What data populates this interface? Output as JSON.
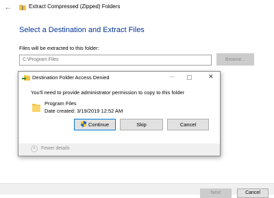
{
  "wizard": {
    "back_icon": "back-arrow-icon",
    "title_icon": "zip-folder-icon",
    "title": "Extract Compressed (Zipped) Folders",
    "heading": "Select a Destination and Extract Files",
    "files_label": "Files will be extracted to this folder:",
    "path_value": "C:\\Program Files",
    "browse_label": "Browse...",
    "next_label": "Next",
    "cancel_label": "Cancel",
    "colors": {
      "heading": "#003399",
      "disabled_button": "#cccccc"
    }
  },
  "dialog": {
    "title_icon": "folder-move-icon",
    "title": "Destination Folder Access Denied",
    "minimize_icon": "minimize-icon",
    "maximize_icon": "maximize-icon",
    "close_icon": "close-icon",
    "message": "You'll need to provide administrator permission to copy to this folder",
    "folder_icon": "folder-icon",
    "folder_name": "Program Files",
    "date_created": "Date created: 3/19/2019 12:52 AM",
    "buttons": {
      "continue_label": "Continue",
      "continue_icon": "uac-shield-icon",
      "skip_label": "Skip",
      "cancel_label": "Cancel"
    },
    "fewer_details_icon": "chevron-up-icon",
    "fewer_details_label": "Fewer details",
    "colors": {
      "focus_border": "#0078d7",
      "folder_yellow": "#f4c342"
    }
  }
}
